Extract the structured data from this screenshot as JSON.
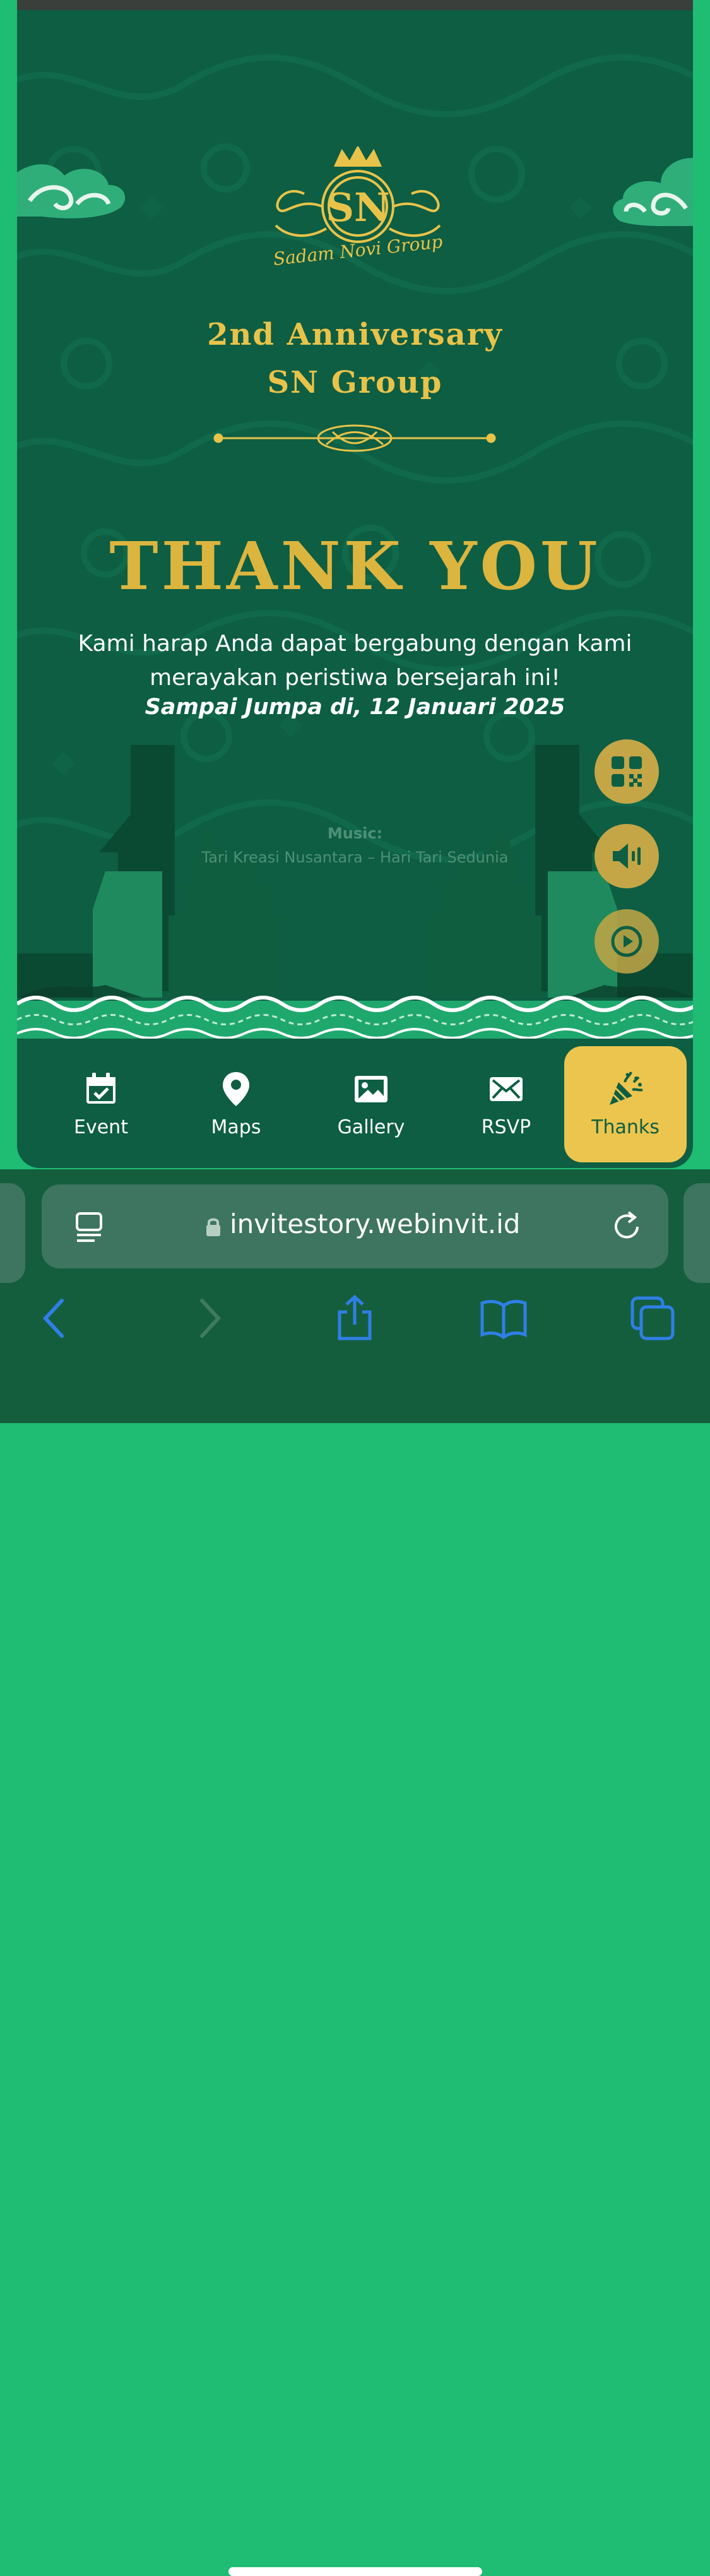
{
  "invitation": {
    "logo_script": "Sadam Novi Group",
    "logo_monogram": "SN",
    "title_line1": "2nd Anniversary",
    "title_line2": "SN Group",
    "thank_you": "THANK YOU",
    "message": "Kami harap Anda dapat bergabung dengan kami merayakan peristiwa bersejarah ini!",
    "date_line": "Sampai Jumpa di, 12 Januari 2025",
    "music_label": "Music:",
    "music_title": "Tari Kreasi Nusantara – Hari Tari Sedunia"
  },
  "floating_buttons": [
    {
      "name": "qr-code-icon"
    },
    {
      "name": "speaker-icon"
    },
    {
      "name": "play-icon"
    }
  ],
  "bottom_nav": {
    "items": [
      {
        "label": "Event",
        "icon": "calendar-check-icon"
      },
      {
        "label": "Maps",
        "icon": "map-pin-icon"
      },
      {
        "label": "Gallery",
        "icon": "image-icon"
      },
      {
        "label": "RSVP",
        "icon": "envelope-icon"
      },
      {
        "label": "Thanks",
        "icon": "party-popper-icon",
        "active": true
      }
    ]
  },
  "browser": {
    "url": "invitestory.webinvit.id"
  },
  "colors": {
    "page_background": "#1ebd73",
    "card_green": "#0d5e43",
    "gold": "#e9c349",
    "active_tab": "#ecc54f",
    "browser_chrome": "#145e3e",
    "toolbar_blue": "#2f7fe6"
  }
}
